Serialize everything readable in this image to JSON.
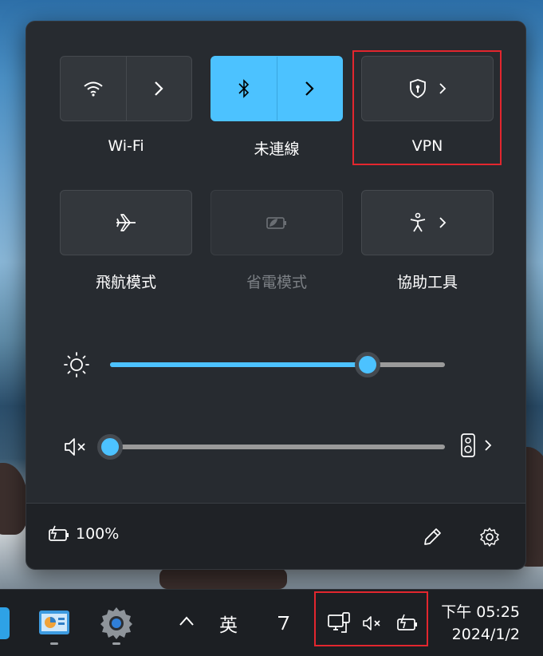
{
  "quick_settings": {
    "tiles": [
      {
        "label": "Wi-Fi",
        "icon": "wifi-icon",
        "state": "off"
      },
      {
        "label": "未連線",
        "icon": "bluetooth-icon",
        "state": "on"
      },
      {
        "label": "VPN",
        "icon": "vpn-shield-icon",
        "state": "off"
      },
      {
        "label": "飛航模式",
        "icon": "airplane-icon",
        "state": "off"
      },
      {
        "label": "省電模式",
        "icon": "battery-saver-icon",
        "state": "disabled"
      },
      {
        "label": "協助工具",
        "icon": "accessibility-icon",
        "state": "off"
      }
    ],
    "brightness_level": 0.77,
    "volume_level": 0.0,
    "battery_text": "100%"
  },
  "taskbar": {
    "ime_label": "英",
    "time": "下午 05:25",
    "date": "2024/1/2"
  },
  "colors": {
    "accent": "#4cc2ff",
    "panel": "#272b30",
    "highlight_box": "#e3262e"
  }
}
